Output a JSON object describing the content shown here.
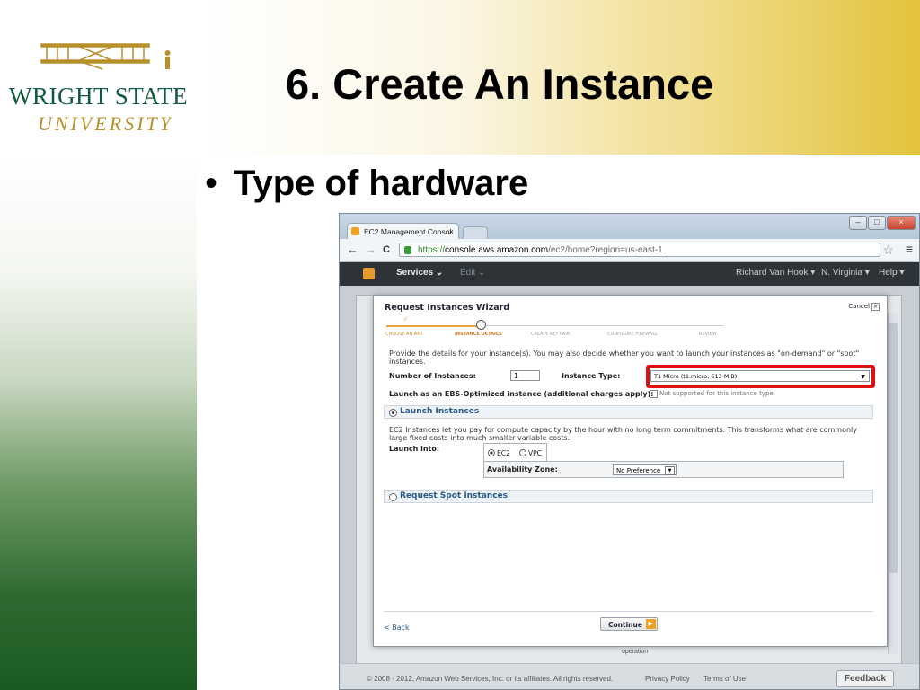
{
  "slide": {
    "title": "6. Create An Instance",
    "bullet_marker": "•",
    "bullet": "Type of hardware",
    "logo": {
      "line1": "WRIGHT STATE",
      "line2": "UNIVERSITY"
    }
  },
  "browser": {
    "tab_title": "EC2 Management Consol",
    "tab_close": "×",
    "url_scheme": "https://",
    "url_host": "console.aws.amazon.com",
    "url_path": "/ec2/home?region=us-east-1",
    "back": "←",
    "forward": "→",
    "reload": "C",
    "star": "☆",
    "menu": "≡",
    "win_min": "–",
    "win_max": "□",
    "win_close": "×"
  },
  "aws_nav": {
    "services": "Services ⌄",
    "edit": "Edit ⌄",
    "user": "Richard Van Hook ▾",
    "region": "N. Virginia ▾",
    "help": "Help ▾"
  },
  "wizard": {
    "title": "Request Instances Wizard",
    "cancel": "Cancel",
    "steps": [
      "CHOOSE AN AMI",
      "INSTANCE DETAILS",
      "CREATE KEY PAIR",
      "CONFIGURE FIREWALL",
      "REVIEW"
    ],
    "description": "Provide the details for your instance(s). You may also decide whether you want to launch your instances as \"on-demand\" or \"spot\" instances.",
    "num_instances_label": "Number of Instances:",
    "num_instances_value": "1",
    "instance_type_label": "Instance Type:",
    "instance_type_value": "T1 Micro (t1.micro, 613 MiB)",
    "ebs_label": "Launch as an EBS-Optimized instance (additional charges apply):",
    "ebs_note": "Not supported for this instance type",
    "launch_section": "Launch Instances",
    "launch_desc": "EC2 Instances let you pay for compute capacity by the hour with no long term commitments. This transforms what are commonly large fixed costs into much smaller variable costs.",
    "launch_into_label": "Launch into:",
    "opt_ec2": "EC2",
    "opt_vpc": "VPC",
    "az_label": "Availability Zone:",
    "az_value": "No Preference",
    "spot_section": "Request Spot Instances",
    "back": "< Back",
    "continue": "Continue"
  },
  "footer": {
    "copyright": "© 2008 - 2012, Amazon Web Services, Inc. or its affiliates. All rights reserved.",
    "privacy": "Privacy Policy",
    "terms": "Terms of Use",
    "feedback": "Feedback",
    "operation": "operation"
  },
  "colors": {
    "highlight": "#e01010",
    "university_green": "#0f5a3a",
    "university_gold": "#b8902a",
    "aws_nav": "#2e3338"
  }
}
